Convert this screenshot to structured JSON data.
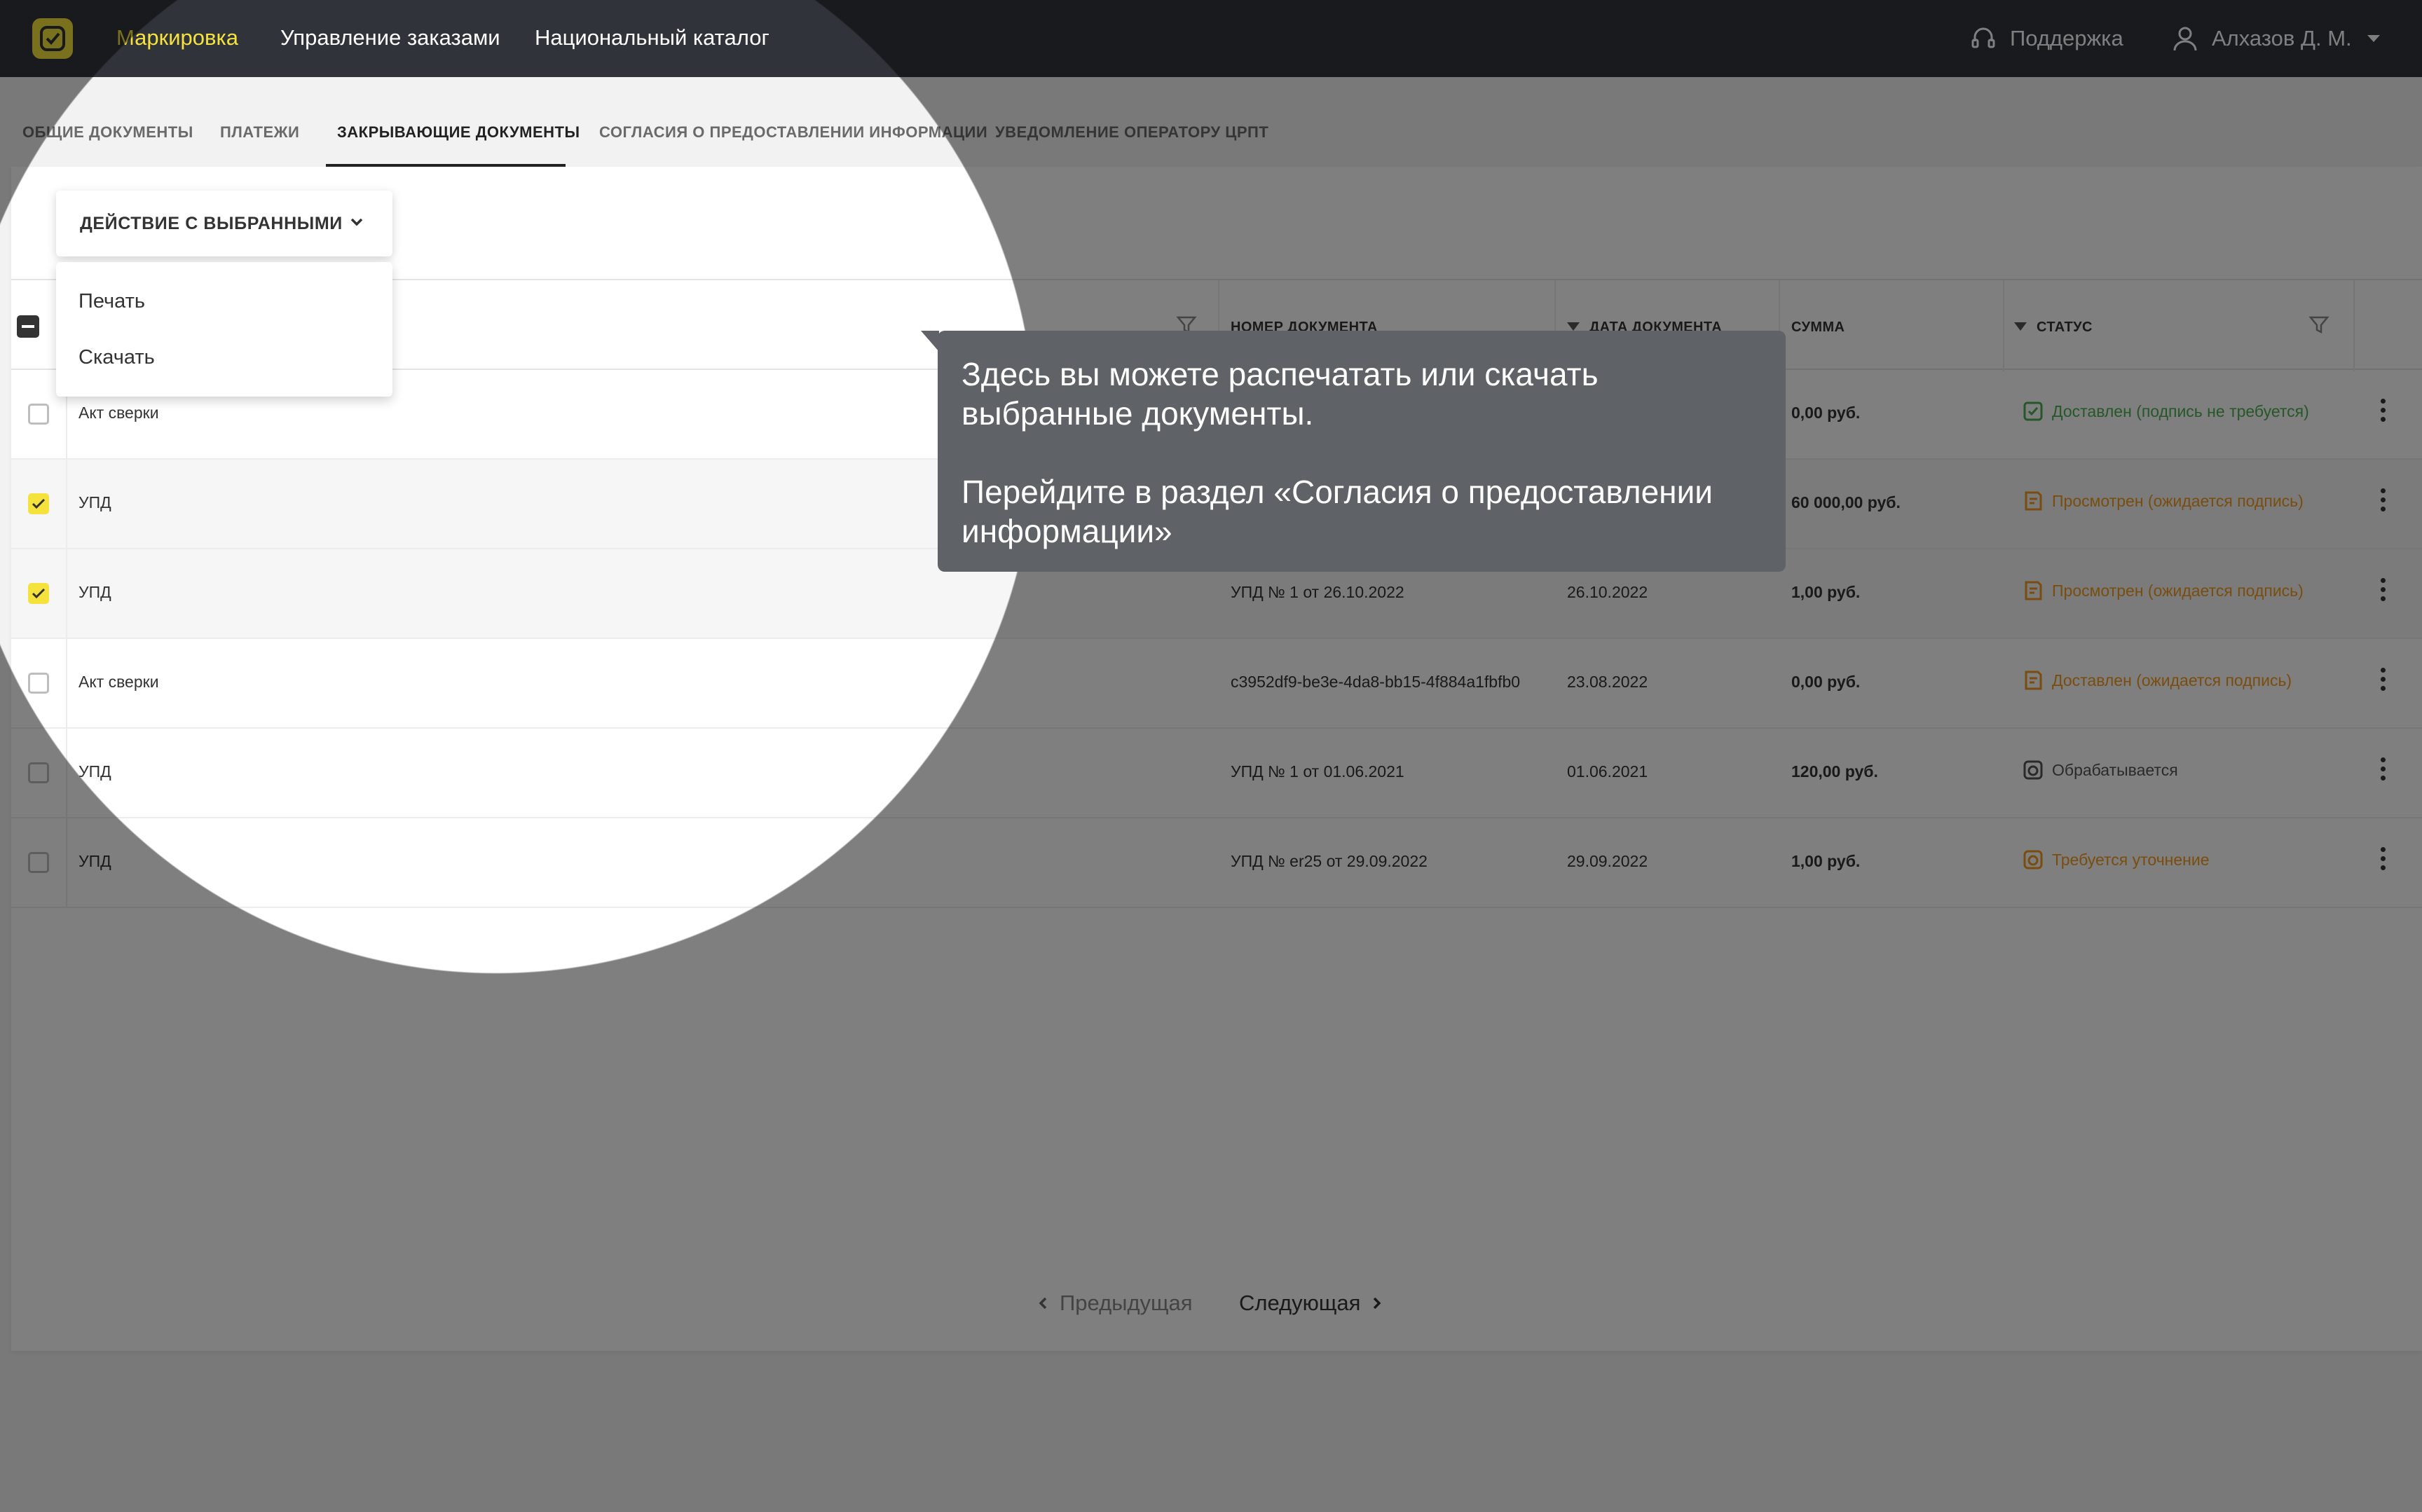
{
  "header": {
    "logo_icon": "marking-logo-icon",
    "nav": [
      "Маркировка",
      "Управление заказами",
      "Национальный каталог"
    ],
    "support_label": "Поддержка",
    "support_icon": "headset-icon",
    "user_name": "Алхазов Д. М.",
    "user_icon": "user-icon"
  },
  "tabs": {
    "items": [
      "ОБЩИЕ ДОКУМЕНТЫ",
      "ПЛАТЕЖИ",
      "ЗАКРЫВАЮЩИЕ ДОКУМЕНТЫ",
      "СОГЛАСИЯ О ПРЕДОСТАВЛЕНИИ ИНФОРМАЦИИ",
      "УВЕДОМЛЕНИЕ ОПЕРАТОРУ ЦРПТ"
    ],
    "active_index": 2
  },
  "actions": {
    "button_label": "ДЕЙСТВИЕ С ВЫБРАННЫМИ",
    "options": [
      "Печать",
      "Скачать"
    ]
  },
  "table": {
    "columns": [
      "НОМЕР ДОКУМЕНТА",
      "ДАТА ДОКУМЕНТА",
      "СУММА",
      "СТАТУС"
    ],
    "rows": [
      {
        "type": "Акт сверки",
        "number": "",
        "date": "",
        "sum": "0,00 руб.",
        "status": "Доставлен (подпись не требуется)",
        "status_color": "#4caf50",
        "checked": false
      },
      {
        "type": "УПД",
        "number": "",
        "date": "",
        "sum": "60 000,00 руб.",
        "status": "Просмотрен (ожидается подпись)",
        "status_color": "#f29b1d",
        "checked": true
      },
      {
        "type": "УПД",
        "number": "УПД № 1 от 26.10.2022",
        "date": "26.10.2022",
        "sum": "1,00 руб.",
        "status": "Просмотрен (ожидается подпись)",
        "status_color": "#f29b1d",
        "checked": true
      },
      {
        "type": "Акт сверки",
        "number": "c3952df9-be3e-4da8-bb15-4f884a1fbfb0",
        "date": "23.08.2022",
        "sum": "0,00 руб.",
        "status": "Доставлен (ожидается подпись)",
        "status_color": "#f29b1d",
        "checked": false
      },
      {
        "type": "УПД",
        "number": "УПД № 1 от 01.06.2021",
        "date": "01.06.2021",
        "sum": "120,00 руб.",
        "status": "Обрабатывается",
        "status_color": "#555555",
        "checked": false
      },
      {
        "type": "УПД",
        "number": "УПД № er25 от 29.09.2022",
        "date": "29.09.2022",
        "sum": "1,00 руб.",
        "status": "Требуется уточнение",
        "status_color": "#f29b1d",
        "checked": false
      }
    ]
  },
  "pager": {
    "prev": "Предыдущая",
    "next": "Следующая"
  },
  "tooltip": {
    "line1": "Здесь вы можете распечатать или скачать выбранные документы.",
    "line2": "Перейдите в раздел «Согласия о предоставлении информации»"
  },
  "colors": {
    "accent": "#f5e23c",
    "topbar": "#30333a",
    "tooltip_bg": "#5f6266"
  }
}
